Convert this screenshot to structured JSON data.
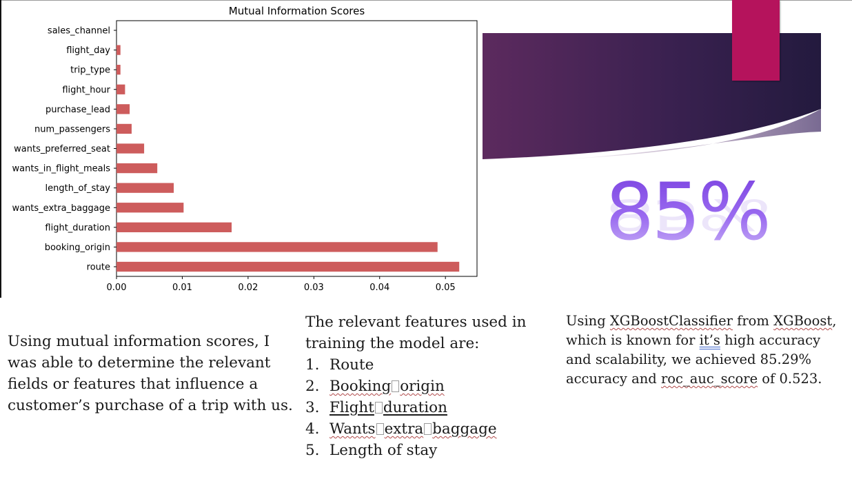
{
  "chart_data": {
    "type": "bar",
    "orientation": "horizontal",
    "title": "Mutual Information Scores",
    "xlabel": "",
    "ylabel": "",
    "categories": [
      "sales_channel",
      "flight_day",
      "trip_type",
      "flight_hour",
      "purchase_lead",
      "num_passengers",
      "wants_preferred_seat",
      "wants_in_flight_meals",
      "length_of_stay",
      "wants_extra_baggage",
      "flight_duration",
      "booking_origin",
      "route"
    ],
    "values": [
      0.0,
      0.0006,
      0.0006,
      0.0013,
      0.002,
      0.0023,
      0.0042,
      0.0062,
      0.0087,
      0.0102,
      0.0175,
      0.0488,
      0.0521
    ],
    "xlim": [
      0.0,
      0.0548
    ],
    "xticks": [
      0.0,
      0.01,
      0.02,
      0.03,
      0.04,
      0.05
    ],
    "xtick_labels": [
      "0.00",
      "0.01",
      "0.02",
      "0.03",
      "0.04",
      "0.05"
    ],
    "bar_color": "#cd5c5c",
    "grid": false
  },
  "accuracy_graphic": {
    "text": "85%",
    "color": "#8b5ce8"
  },
  "banner_colors": {
    "dark": "#2d1c48",
    "purple": "#5c2a5e",
    "accent": "#b5135c"
  },
  "left_paragraph": {
    "text": "Using mutual information scores, I was able to determine the relevant fields or features that influence a customer’s purchase of a trip with us."
  },
  "features_intro": "The relevant features used in training the model are:",
  "features": [
    {
      "num": "1.",
      "parts": [
        "Route"
      ]
    },
    {
      "num": "2.",
      "parts": [
        "Booking",
        "origin"
      ]
    },
    {
      "num": "3.",
      "parts": [
        "Flight",
        "duration"
      ]
    },
    {
      "num": "4.",
      "parts": [
        "Wants",
        "extra",
        "baggage"
      ]
    },
    {
      "num": "5.",
      "parts": [
        "Length of stay"
      ]
    }
  ],
  "right_paragraph": {
    "prefix": "Using ",
    "classifier": "XGBoostClassifier",
    "mid1": " from ",
    "library": "XGBoost",
    "mid2": ", which is known for ",
    "its": "it’s",
    "mid3": " high accuracy and scalability, we achieved 85.29% accuracy and ",
    "metric": "roc_auc_score",
    "suffix": " of 0.523."
  }
}
